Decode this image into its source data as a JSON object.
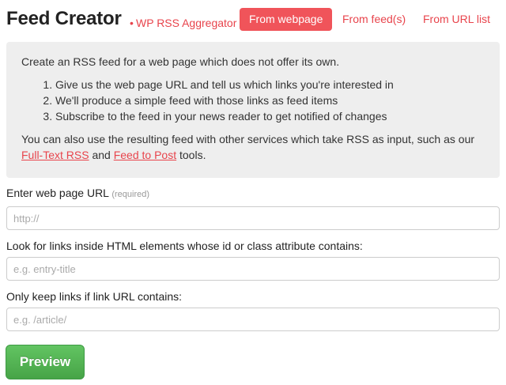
{
  "header": {
    "title": "Feed Creator",
    "separator": "•",
    "subtitle": "WP RSS Aggregator",
    "tabs": [
      {
        "label": "From webpage",
        "active": true
      },
      {
        "label": "From feed(s)",
        "active": false
      },
      {
        "label": "From URL list",
        "active": false
      }
    ]
  },
  "intro": {
    "lead": "Create an RSS feed for a web page which does not offer its own.",
    "steps": [
      "Give us the web page URL and tell us which links you're interested in",
      "We'll produce a simple feed with those links as feed items",
      "Subscribe to the feed in your news reader to get notified of changes"
    ],
    "also_prefix": "You can also use the resulting feed with other services which take RSS as input, such as our",
    "link_fulltext": "Full-Text RSS",
    "also_and": "and",
    "link_feedtopost": "Feed to Post",
    "also_suffix": "tools."
  },
  "form": {
    "url_label": "Enter web page URL",
    "url_required": "(required)",
    "url_placeholder": "http://",
    "elements_label": "Look for links inside HTML elements whose id or class attribute contains:",
    "elements_placeholder": "e.g. entry-title",
    "contains_label": "Only keep links if link URL contains:",
    "contains_placeholder": "e.g. /article/",
    "preview_label": "Preview"
  },
  "colors": {
    "accent": "#e8444c",
    "active_tab": "#f0545a",
    "button_green": "#47a447",
    "panel_bg": "#eeeeee"
  }
}
